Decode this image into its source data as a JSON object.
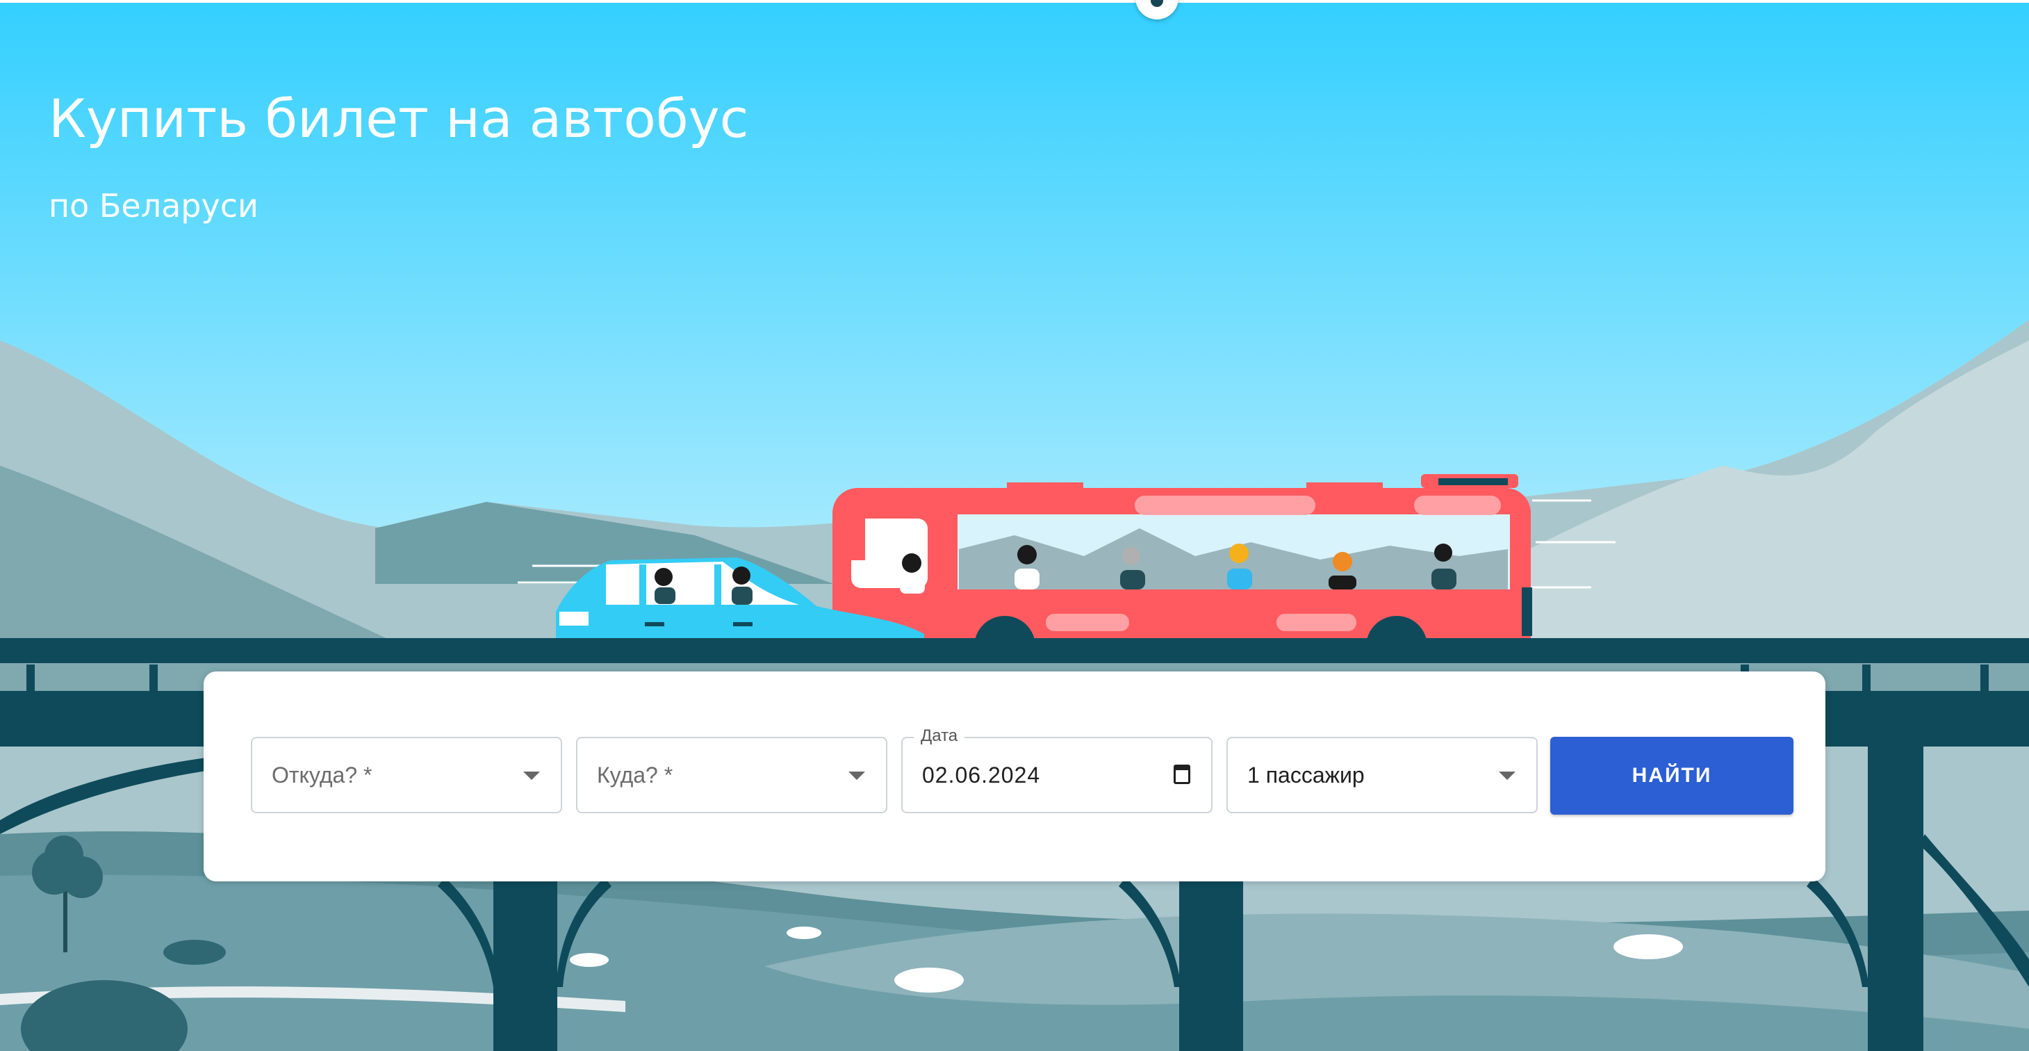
{
  "hero": {
    "title": "Купить билет на автобус",
    "subtitle": "по Беларуси"
  },
  "search": {
    "from_placeholder": "Откуда? *",
    "to_placeholder": "Куда? *",
    "date_label": "Дата",
    "date_value": "02.06.2024",
    "passengers_value": "1 пассажир",
    "submit_label": "НАЙТИ"
  },
  "colors": {
    "sky": "#33CFFF",
    "bridge": "#0E4A5A",
    "bus": "#FF5A5F",
    "car": "#33CCF5",
    "button": "#2B5FD3",
    "title_text": "#FFFFFF"
  },
  "icons": {
    "field_caret": "chevron-down-icon",
    "date_picker": "calendar-icon"
  }
}
